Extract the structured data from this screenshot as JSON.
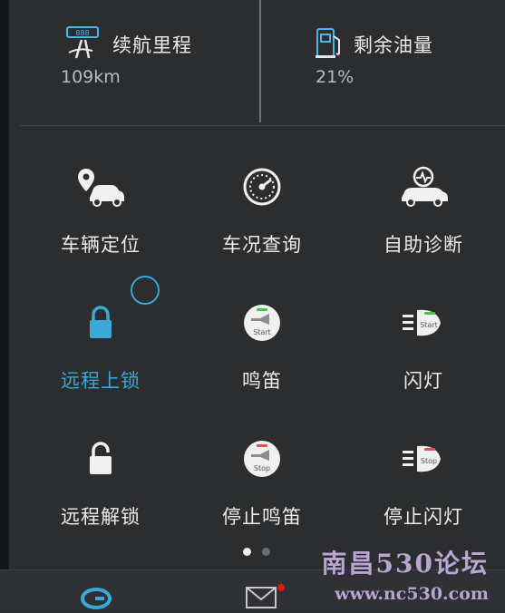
{
  "stats": {
    "range": {
      "title": "续航里程",
      "value": "109km",
      "icon": "road-icon"
    },
    "fuel": {
      "title": "剩余油量",
      "value": "21%",
      "icon": "fuel-pump-icon"
    }
  },
  "grid": [
    {
      "label": "车辆定位",
      "icon": "car-location-icon"
    },
    {
      "label": "车况查询",
      "icon": "gauge-icon"
    },
    {
      "label": "自助诊断",
      "icon": "car-diagnosis-icon"
    },
    {
      "label": "远程上锁",
      "icon": "lock-icon",
      "active": true
    },
    {
      "label": "鸣笛",
      "icon": "horn-start-icon",
      "badge": "Start"
    },
    {
      "label": "闪灯",
      "icon": "light-start-icon",
      "badge": "Start"
    },
    {
      "label": "远程解锁",
      "icon": "unlock-icon"
    },
    {
      "label": "停止鸣笛",
      "icon": "horn-stop-icon",
      "badge": "Stop"
    },
    {
      "label": "停止闪灯",
      "icon": "light-stop-icon",
      "badge": "Stop"
    }
  ],
  "pager": {
    "count": 2,
    "current": 1
  },
  "watermark": {
    "title": "南昌530论坛",
    "url": "www.nc530.com"
  },
  "colors": {
    "accent": "#3aa8d8",
    "background": "#2b2d2f",
    "notification": "#e01818"
  }
}
